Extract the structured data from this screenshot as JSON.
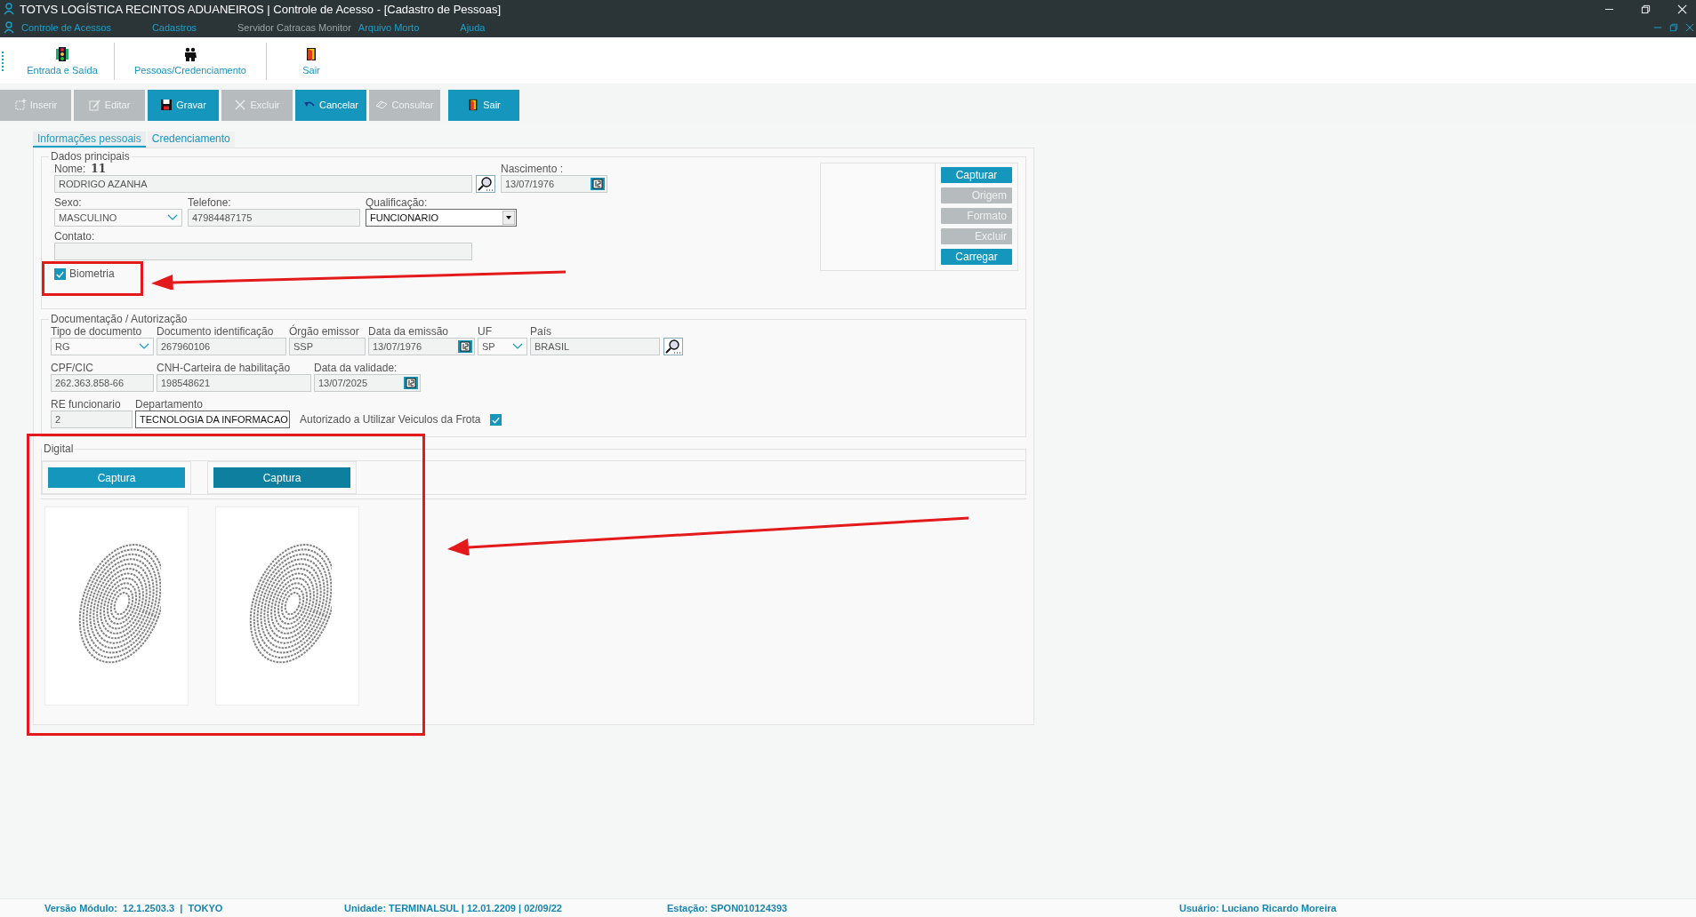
{
  "window": {
    "title": "TOTVS LOGÍSTICA RECINTOS ADUANEIROS | Controle de Acesso - [Cadastro de Pessoas]"
  },
  "menu": [
    {
      "label": "Controle de Acessos",
      "disabled": false
    },
    {
      "label": "Cadastros",
      "disabled": false
    },
    {
      "label": "Servidor Catracas Monitor",
      "disabled": true
    },
    {
      "label": "Arquivo Morto",
      "disabled": false
    },
    {
      "label": "Ajuda",
      "disabled": false
    }
  ],
  "quick_toolbar": [
    {
      "label": "Entrada e Saída",
      "kind": "traffic"
    },
    {
      "label": "Pessoas/Credenciamento",
      "kind": "people"
    },
    {
      "label": "Sair",
      "kind": "door"
    }
  ],
  "actions": [
    {
      "label": "Inserir",
      "kind": "insert",
      "disabled": true
    },
    {
      "label": "Editar",
      "kind": "edit",
      "disabled": true
    },
    {
      "label": "Gravar",
      "kind": "save",
      "disabled": false
    },
    {
      "label": "Excluir",
      "kind": "delete",
      "disabled": true
    },
    {
      "label": "Cancelar",
      "kind": "undo",
      "disabled": false
    },
    {
      "label": "Consultar",
      "kind": "query",
      "disabled": true
    },
    {
      "label": "Sair",
      "kind": "door",
      "disabled": false
    }
  ],
  "tabs": [
    {
      "label": "Informações pessoais",
      "selected": true
    },
    {
      "label": "Credenciamento",
      "selected": false
    }
  ],
  "dados_principais": {
    "title": "Dados principais",
    "nome_label": "Nome:",
    "nome_code": "11",
    "nome": "RODRIGO AZANHA",
    "nascimento_label": "Nascimento :",
    "nascimento": "13/07/1976",
    "sexo_label": "Sexo:",
    "sexo": "MASCULINO",
    "telefone_label": "Telefone:",
    "telefone": "47984487175",
    "qualificacao_label": "Qualificação:",
    "qualificacao": "FUNCIONARIO",
    "contato_label": "Contato:",
    "biometria": {
      "label": "Biometria",
      "checked": true
    },
    "photo_buttons": [
      {
        "label": "Capturar",
        "disabled": false
      },
      {
        "label": "Origem",
        "disabled": true
      },
      {
        "label": "Formato",
        "disabled": true
      },
      {
        "label": "Excluir",
        "disabled": true
      },
      {
        "label": "Carregar",
        "disabled": false
      }
    ]
  },
  "documentacao": {
    "title": "Documentação / Autorização",
    "tipo_label": "Tipo de documento",
    "tipo": "RG",
    "doc_label": "Documento identificação",
    "doc": "267960106",
    "orgao_label": "Órgão emissor",
    "orgao": "SSP",
    "emissao_label": "Data da emissão",
    "emissao": "13/07/1976",
    "uf_label": "UF",
    "uf": "SP",
    "pais_label": "País",
    "pais": "BRASIL",
    "cpf_label": "CPF/CIC",
    "cpf": "262.363.858-66",
    "cnh_label": "CNH-Carteira de habilitação",
    "cnh": "198548621",
    "validade_label": "Data da validade:",
    "validade": "13/07/2025",
    "re_label": "RE funcionario",
    "re": "2",
    "departamento_label": "Departamento",
    "departamento": "TECNOLOGIA DA INFORMACAO",
    "frota": {
      "label": "Autorizado a Utilizar Veiculos da Frota",
      "checked": true
    }
  },
  "digital": {
    "title": "Digital",
    "buttons": [
      "Captura",
      "Captura"
    ]
  },
  "status_bar": [
    "Versão Módulo:  12.1.2503.3  |  TOKYO",
    "Unidade: TERMINALSUL | 12.01.2209 | 02/09/22",
    "Estação: SPON010124393",
    "Usuário: Luciano Ricardo Moreira"
  ]
}
